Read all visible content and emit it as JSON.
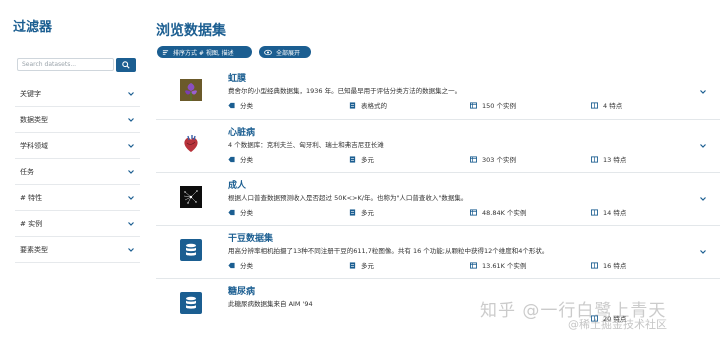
{
  "sidebar": {
    "title": "过滤器",
    "search": {
      "placeholder": "Search datasets..."
    },
    "filters": [
      {
        "label": "关键字"
      },
      {
        "label": "数据类型"
      },
      {
        "label": "学科领域"
      },
      {
        "label": "任务"
      },
      {
        "label": "# 特性"
      },
      {
        "label": "# 实例"
      },
      {
        "label": "要素类型"
      }
    ]
  },
  "main": {
    "title": "浏览数据集",
    "sort_label": "排序方式 # 视图, 描述",
    "expand_label": "全部展开",
    "datasets": [
      {
        "name": "虹膜",
        "description": "费舍尔的小型经典数据集，1936 年。已知最早用于评估分类方法的数据集之一。",
        "task": "分类",
        "type": "表格式的",
        "instances": "150 个实例",
        "features": "4 特点",
        "thumb": "iris-flower-image"
      },
      {
        "name": "心脏病",
        "description": "4 个数据库：克利夫兰、匈牙利、瑞士和弗吉尼亚长滩",
        "task": "分类",
        "type": "多元",
        "instances": "303 个实例",
        "features": "13 特点",
        "thumb": "heart-image"
      },
      {
        "name": "成人",
        "description": "根据人口普查数据预测收入是否超过 50K<>K/年。也称为\"人口普查收入\"数据集。",
        "task": "分类",
        "type": "多元",
        "instances": "48.84K 个实例",
        "features": "14 特点",
        "thumb": "census-image"
      },
      {
        "name": "干豆数据集",
        "description": "用高分辨率相机拍摄了13种不同注册干豆的611,7粒图像。共有 16 个功能;从颗粒中获得12个维度和4个形状。",
        "task": "分类",
        "type": "多元",
        "instances": "13.61K 个实例",
        "features": "16 特点",
        "thumb": "database-icon"
      },
      {
        "name": "糖尿病",
        "description": "此糖尿病数据集来自 AIM '94",
        "features": "20 特点",
        "thumb": "database-icon"
      }
    ]
  },
  "watermark": {
    "line1": "知乎 @一行白鹭上青天",
    "line2": "@稀土掘金技术社区"
  },
  "colors": {
    "accent": "#1b5e91"
  }
}
